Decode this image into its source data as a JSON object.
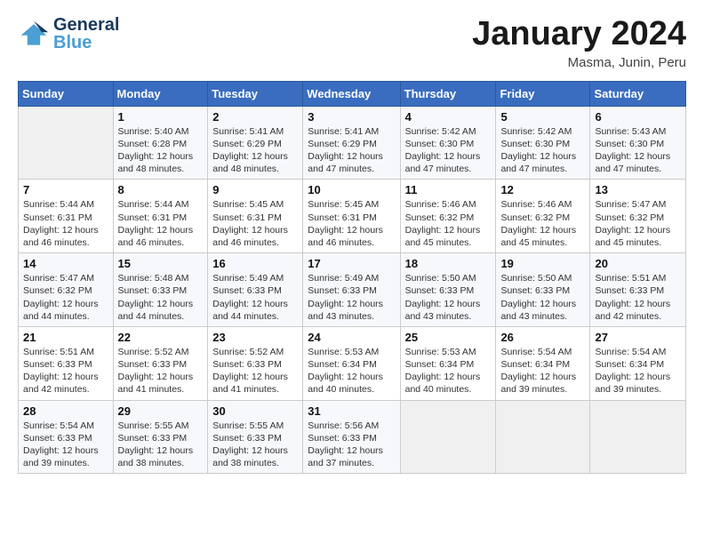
{
  "header": {
    "logo_general": "General",
    "logo_blue": "Blue",
    "month_title": "January 2024",
    "location": "Masma, Junin, Peru"
  },
  "weekdays": [
    "Sunday",
    "Monday",
    "Tuesday",
    "Wednesday",
    "Thursday",
    "Friday",
    "Saturday"
  ],
  "weeks": [
    [
      {
        "day": "",
        "sunrise": "",
        "sunset": "",
        "daylight": ""
      },
      {
        "day": "1",
        "sunrise": "Sunrise: 5:40 AM",
        "sunset": "Sunset: 6:28 PM",
        "daylight": "Daylight: 12 hours and 48 minutes."
      },
      {
        "day": "2",
        "sunrise": "Sunrise: 5:41 AM",
        "sunset": "Sunset: 6:29 PM",
        "daylight": "Daylight: 12 hours and 48 minutes."
      },
      {
        "day": "3",
        "sunrise": "Sunrise: 5:41 AM",
        "sunset": "Sunset: 6:29 PM",
        "daylight": "Daylight: 12 hours and 47 minutes."
      },
      {
        "day": "4",
        "sunrise": "Sunrise: 5:42 AM",
        "sunset": "Sunset: 6:30 PM",
        "daylight": "Daylight: 12 hours and 47 minutes."
      },
      {
        "day": "5",
        "sunrise": "Sunrise: 5:42 AM",
        "sunset": "Sunset: 6:30 PM",
        "daylight": "Daylight: 12 hours and 47 minutes."
      },
      {
        "day": "6",
        "sunrise": "Sunrise: 5:43 AM",
        "sunset": "Sunset: 6:30 PM",
        "daylight": "Daylight: 12 hours and 47 minutes."
      }
    ],
    [
      {
        "day": "7",
        "sunrise": "Sunrise: 5:44 AM",
        "sunset": "Sunset: 6:31 PM",
        "daylight": "Daylight: 12 hours and 46 minutes."
      },
      {
        "day": "8",
        "sunrise": "Sunrise: 5:44 AM",
        "sunset": "Sunset: 6:31 PM",
        "daylight": "Daylight: 12 hours and 46 minutes."
      },
      {
        "day": "9",
        "sunrise": "Sunrise: 5:45 AM",
        "sunset": "Sunset: 6:31 PM",
        "daylight": "Daylight: 12 hours and 46 minutes."
      },
      {
        "day": "10",
        "sunrise": "Sunrise: 5:45 AM",
        "sunset": "Sunset: 6:31 PM",
        "daylight": "Daylight: 12 hours and 46 minutes."
      },
      {
        "day": "11",
        "sunrise": "Sunrise: 5:46 AM",
        "sunset": "Sunset: 6:32 PM",
        "daylight": "Daylight: 12 hours and 45 minutes."
      },
      {
        "day": "12",
        "sunrise": "Sunrise: 5:46 AM",
        "sunset": "Sunset: 6:32 PM",
        "daylight": "Daylight: 12 hours and 45 minutes."
      },
      {
        "day": "13",
        "sunrise": "Sunrise: 5:47 AM",
        "sunset": "Sunset: 6:32 PM",
        "daylight": "Daylight: 12 hours and 45 minutes."
      }
    ],
    [
      {
        "day": "14",
        "sunrise": "Sunrise: 5:47 AM",
        "sunset": "Sunset: 6:32 PM",
        "daylight": "Daylight: 12 hours and 44 minutes."
      },
      {
        "day": "15",
        "sunrise": "Sunrise: 5:48 AM",
        "sunset": "Sunset: 6:33 PM",
        "daylight": "Daylight: 12 hours and 44 minutes."
      },
      {
        "day": "16",
        "sunrise": "Sunrise: 5:49 AM",
        "sunset": "Sunset: 6:33 PM",
        "daylight": "Daylight: 12 hours and 44 minutes."
      },
      {
        "day": "17",
        "sunrise": "Sunrise: 5:49 AM",
        "sunset": "Sunset: 6:33 PM",
        "daylight": "Daylight: 12 hours and 43 minutes."
      },
      {
        "day": "18",
        "sunrise": "Sunrise: 5:50 AM",
        "sunset": "Sunset: 6:33 PM",
        "daylight": "Daylight: 12 hours and 43 minutes."
      },
      {
        "day": "19",
        "sunrise": "Sunrise: 5:50 AM",
        "sunset": "Sunset: 6:33 PM",
        "daylight": "Daylight: 12 hours and 43 minutes."
      },
      {
        "day": "20",
        "sunrise": "Sunrise: 5:51 AM",
        "sunset": "Sunset: 6:33 PM",
        "daylight": "Daylight: 12 hours and 42 minutes."
      }
    ],
    [
      {
        "day": "21",
        "sunrise": "Sunrise: 5:51 AM",
        "sunset": "Sunset: 6:33 PM",
        "daylight": "Daylight: 12 hours and 42 minutes."
      },
      {
        "day": "22",
        "sunrise": "Sunrise: 5:52 AM",
        "sunset": "Sunset: 6:33 PM",
        "daylight": "Daylight: 12 hours and 41 minutes."
      },
      {
        "day": "23",
        "sunrise": "Sunrise: 5:52 AM",
        "sunset": "Sunset: 6:33 PM",
        "daylight": "Daylight: 12 hours and 41 minutes."
      },
      {
        "day": "24",
        "sunrise": "Sunrise: 5:53 AM",
        "sunset": "Sunset: 6:34 PM",
        "daylight": "Daylight: 12 hours and 40 minutes."
      },
      {
        "day": "25",
        "sunrise": "Sunrise: 5:53 AM",
        "sunset": "Sunset: 6:34 PM",
        "daylight": "Daylight: 12 hours and 40 minutes."
      },
      {
        "day": "26",
        "sunrise": "Sunrise: 5:54 AM",
        "sunset": "Sunset: 6:34 PM",
        "daylight": "Daylight: 12 hours and 39 minutes."
      },
      {
        "day": "27",
        "sunrise": "Sunrise: 5:54 AM",
        "sunset": "Sunset: 6:34 PM",
        "daylight": "Daylight: 12 hours and 39 minutes."
      }
    ],
    [
      {
        "day": "28",
        "sunrise": "Sunrise: 5:54 AM",
        "sunset": "Sunset: 6:33 PM",
        "daylight": "Daylight: 12 hours and 39 minutes."
      },
      {
        "day": "29",
        "sunrise": "Sunrise: 5:55 AM",
        "sunset": "Sunset: 6:33 PM",
        "daylight": "Daylight: 12 hours and 38 minutes."
      },
      {
        "day": "30",
        "sunrise": "Sunrise: 5:55 AM",
        "sunset": "Sunset: 6:33 PM",
        "daylight": "Daylight: 12 hours and 38 minutes."
      },
      {
        "day": "31",
        "sunrise": "Sunrise: 5:56 AM",
        "sunset": "Sunset: 6:33 PM",
        "daylight": "Daylight: 12 hours and 37 minutes."
      },
      {
        "day": "",
        "sunrise": "",
        "sunset": "",
        "daylight": ""
      },
      {
        "day": "",
        "sunrise": "",
        "sunset": "",
        "daylight": ""
      },
      {
        "day": "",
        "sunrise": "",
        "sunset": "",
        "daylight": ""
      }
    ]
  ]
}
